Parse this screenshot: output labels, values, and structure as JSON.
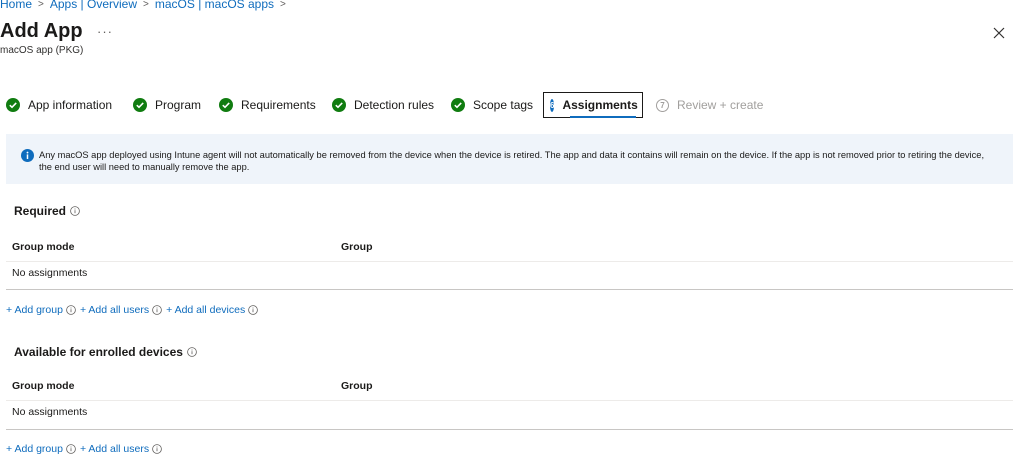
{
  "breadcrumb": {
    "items": [
      "Home",
      "Apps | Overview",
      "macOS | macOS apps"
    ]
  },
  "header": {
    "title": "Add App",
    "more_label": "···",
    "subtitle": "macOS app (PKG)"
  },
  "tabs": [
    {
      "label": "App information",
      "state": "complete"
    },
    {
      "label": "Program",
      "state": "complete"
    },
    {
      "label": "Requirements",
      "state": "complete"
    },
    {
      "label": "Detection rules",
      "state": "complete"
    },
    {
      "label": "Scope tags",
      "state": "complete"
    },
    {
      "label": "Assignments",
      "number": "6",
      "state": "active"
    },
    {
      "label": "Review + create",
      "number": "7",
      "state": "disabled"
    }
  ],
  "banner": {
    "text": "Any macOS app deployed using Intune agent will not automatically be removed from the device when the device is retired. The app and data it contains will remain on the device. If the app is not removed prior to retiring the device, the end user will need to manually remove the app."
  },
  "required": {
    "title": "Required",
    "columns": [
      "Group mode",
      "Group"
    ],
    "empty_text": "No assignments",
    "actions": [
      "+ Add group",
      "+ Add all users",
      "+ Add all devices"
    ]
  },
  "available": {
    "title": "Available for enrolled devices",
    "columns": [
      "Group mode",
      "Group"
    ],
    "empty_text": "No assignments",
    "actions": [
      "+ Add group",
      "+ Add all users"
    ]
  },
  "colors": {
    "accent": "#0f6cbd",
    "success": "#107c10",
    "banner_bg": "#eff4fa"
  }
}
